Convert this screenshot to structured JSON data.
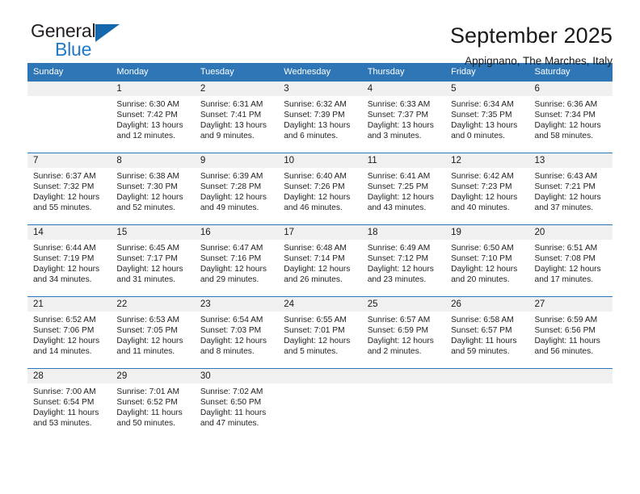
{
  "brand": {
    "line1": "General",
    "line2": "Blue",
    "accent_color": "#1668ad"
  },
  "header": {
    "title": "September 2025",
    "subtitle": "Appignano, The Marches, Italy",
    "header_color": "#2e76b5"
  },
  "calendar": {
    "weekday_headers": [
      "Sunday",
      "Monday",
      "Tuesday",
      "Wednesday",
      "Thursday",
      "Friday",
      "Saturday"
    ],
    "weeks": [
      [
        {
          "day": "",
          "lines": []
        },
        {
          "day": "1",
          "lines": [
            "Sunrise: 6:30 AM",
            "Sunset: 7:42 PM",
            "Daylight: 13 hours",
            "and 12 minutes."
          ]
        },
        {
          "day": "2",
          "lines": [
            "Sunrise: 6:31 AM",
            "Sunset: 7:41 PM",
            "Daylight: 13 hours",
            "and 9 minutes."
          ]
        },
        {
          "day": "3",
          "lines": [
            "Sunrise: 6:32 AM",
            "Sunset: 7:39 PM",
            "Daylight: 13 hours",
            "and 6 minutes."
          ]
        },
        {
          "day": "4",
          "lines": [
            "Sunrise: 6:33 AM",
            "Sunset: 7:37 PM",
            "Daylight: 13 hours",
            "and 3 minutes."
          ]
        },
        {
          "day": "5",
          "lines": [
            "Sunrise: 6:34 AM",
            "Sunset: 7:35 PM",
            "Daylight: 13 hours",
            "and 0 minutes."
          ]
        },
        {
          "day": "6",
          "lines": [
            "Sunrise: 6:36 AM",
            "Sunset: 7:34 PM",
            "Daylight: 12 hours",
            "and 58 minutes."
          ]
        }
      ],
      [
        {
          "day": "7",
          "lines": [
            "Sunrise: 6:37 AM",
            "Sunset: 7:32 PM",
            "Daylight: 12 hours",
            "and 55 minutes."
          ]
        },
        {
          "day": "8",
          "lines": [
            "Sunrise: 6:38 AM",
            "Sunset: 7:30 PM",
            "Daylight: 12 hours",
            "and 52 minutes."
          ]
        },
        {
          "day": "9",
          "lines": [
            "Sunrise: 6:39 AM",
            "Sunset: 7:28 PM",
            "Daylight: 12 hours",
            "and 49 minutes."
          ]
        },
        {
          "day": "10",
          "lines": [
            "Sunrise: 6:40 AM",
            "Sunset: 7:26 PM",
            "Daylight: 12 hours",
            "and 46 minutes."
          ]
        },
        {
          "day": "11",
          "lines": [
            "Sunrise: 6:41 AM",
            "Sunset: 7:25 PM",
            "Daylight: 12 hours",
            "and 43 minutes."
          ]
        },
        {
          "day": "12",
          "lines": [
            "Sunrise: 6:42 AM",
            "Sunset: 7:23 PM",
            "Daylight: 12 hours",
            "and 40 minutes."
          ]
        },
        {
          "day": "13",
          "lines": [
            "Sunrise: 6:43 AM",
            "Sunset: 7:21 PM",
            "Daylight: 12 hours",
            "and 37 minutes."
          ]
        }
      ],
      [
        {
          "day": "14",
          "lines": [
            "Sunrise: 6:44 AM",
            "Sunset: 7:19 PM",
            "Daylight: 12 hours",
            "and 34 minutes."
          ]
        },
        {
          "day": "15",
          "lines": [
            "Sunrise: 6:45 AM",
            "Sunset: 7:17 PM",
            "Daylight: 12 hours",
            "and 31 minutes."
          ]
        },
        {
          "day": "16",
          "lines": [
            "Sunrise: 6:47 AM",
            "Sunset: 7:16 PM",
            "Daylight: 12 hours",
            "and 29 minutes."
          ]
        },
        {
          "day": "17",
          "lines": [
            "Sunrise: 6:48 AM",
            "Sunset: 7:14 PM",
            "Daylight: 12 hours",
            "and 26 minutes."
          ]
        },
        {
          "day": "18",
          "lines": [
            "Sunrise: 6:49 AM",
            "Sunset: 7:12 PM",
            "Daylight: 12 hours",
            "and 23 minutes."
          ]
        },
        {
          "day": "19",
          "lines": [
            "Sunrise: 6:50 AM",
            "Sunset: 7:10 PM",
            "Daylight: 12 hours",
            "and 20 minutes."
          ]
        },
        {
          "day": "20",
          "lines": [
            "Sunrise: 6:51 AM",
            "Sunset: 7:08 PM",
            "Daylight: 12 hours",
            "and 17 minutes."
          ]
        }
      ],
      [
        {
          "day": "21",
          "lines": [
            "Sunrise: 6:52 AM",
            "Sunset: 7:06 PM",
            "Daylight: 12 hours",
            "and 14 minutes."
          ]
        },
        {
          "day": "22",
          "lines": [
            "Sunrise: 6:53 AM",
            "Sunset: 7:05 PM",
            "Daylight: 12 hours",
            "and 11 minutes."
          ]
        },
        {
          "day": "23",
          "lines": [
            "Sunrise: 6:54 AM",
            "Sunset: 7:03 PM",
            "Daylight: 12 hours",
            "and 8 minutes."
          ]
        },
        {
          "day": "24",
          "lines": [
            "Sunrise: 6:55 AM",
            "Sunset: 7:01 PM",
            "Daylight: 12 hours",
            "and 5 minutes."
          ]
        },
        {
          "day": "25",
          "lines": [
            "Sunrise: 6:57 AM",
            "Sunset: 6:59 PM",
            "Daylight: 12 hours",
            "and 2 minutes."
          ]
        },
        {
          "day": "26",
          "lines": [
            "Sunrise: 6:58 AM",
            "Sunset: 6:57 PM",
            "Daylight: 11 hours",
            "and 59 minutes."
          ]
        },
        {
          "day": "27",
          "lines": [
            "Sunrise: 6:59 AM",
            "Sunset: 6:56 PM",
            "Daylight: 11 hours",
            "and 56 minutes."
          ]
        }
      ],
      [
        {
          "day": "28",
          "lines": [
            "Sunrise: 7:00 AM",
            "Sunset: 6:54 PM",
            "Daylight: 11 hours",
            "and 53 minutes."
          ]
        },
        {
          "day": "29",
          "lines": [
            "Sunrise: 7:01 AM",
            "Sunset: 6:52 PM",
            "Daylight: 11 hours",
            "and 50 minutes."
          ]
        },
        {
          "day": "30",
          "lines": [
            "Sunrise: 7:02 AM",
            "Sunset: 6:50 PM",
            "Daylight: 11 hours",
            "and 47 minutes."
          ]
        },
        {
          "day": "",
          "lines": []
        },
        {
          "day": "",
          "lines": []
        },
        {
          "day": "",
          "lines": []
        },
        {
          "day": "",
          "lines": []
        }
      ]
    ]
  }
}
